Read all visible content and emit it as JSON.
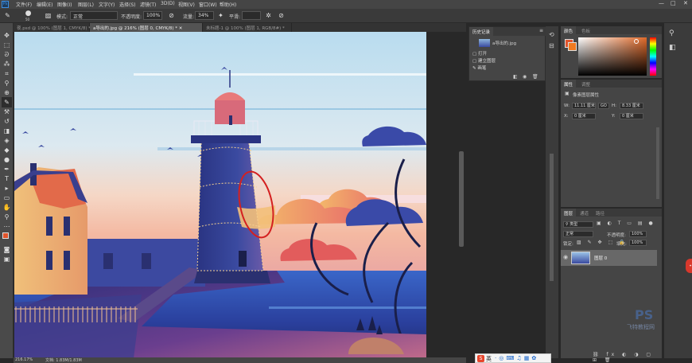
{
  "menubar": {
    "items": [
      "文件(F)",
      "编辑(E)",
      "图像(I)",
      "图层(L)",
      "文字(Y)",
      "选择(S)",
      "滤镜(T)",
      "3D(D)",
      "视图(V)",
      "窗口(W)",
      "帮助(H)"
    ],
    "min_icon": "—",
    "max_icon": "□",
    "close_icon": "✕"
  },
  "options": {
    "mode_label": "模式:",
    "mode_value": "正常",
    "opacity_label": "不透明度:",
    "opacity_value": "100%",
    "flow_label": "流量:",
    "flow_value": "34%",
    "smooth_label": "平滑:",
    "smooth_value": "",
    "brush_size": "50"
  },
  "tabs": [
    {
      "label": "夜.psd @ 100% (图层 1, CMYK/8) *",
      "active": false
    },
    {
      "label": "a导出的.jpg @ 216% (图层 0, CMYK/8) *",
      "active": true
    },
    {
      "label": "未标题-1 @ 100% (图层 1, RGB/8#) *",
      "active": false
    }
  ],
  "status": {
    "zoom": "216.17%",
    "doc": "文档: 1.83M/1.83M"
  },
  "history": {
    "tab1": "历史记录",
    "tab2": "",
    "snapshot": "a导出的.jpg",
    "items": [
      "打开",
      "建立图层",
      "画笔"
    ]
  },
  "color_panel": {
    "tab1": "颜色",
    "tab2": "色板"
  },
  "props": {
    "tab1": "属性",
    "tab2": "调整",
    "title": "像素图层属性",
    "w_label": "W:",
    "w_value": "11.11 厘米",
    "h_label": "H:",
    "h_value": "8.33 厘米",
    "x_label": "X:",
    "x_value": "0 厘米",
    "y_label": "Y:",
    "y_value": "0 厘米",
    "go_label": "GO"
  },
  "layers": {
    "tab1": "图层",
    "tab2": "通道",
    "tab3": "路径",
    "kind": "类型",
    "blend": "正常",
    "opacity_label": "不透明度:",
    "opacity": "100%",
    "lock_label": "锁定:",
    "fill_label": "填充:",
    "fill": "100%",
    "layer_name": "图层 0"
  },
  "watermark": {
    "brand": "PS",
    "text": "飞特教程网"
  },
  "ime": {
    "label": "英"
  }
}
